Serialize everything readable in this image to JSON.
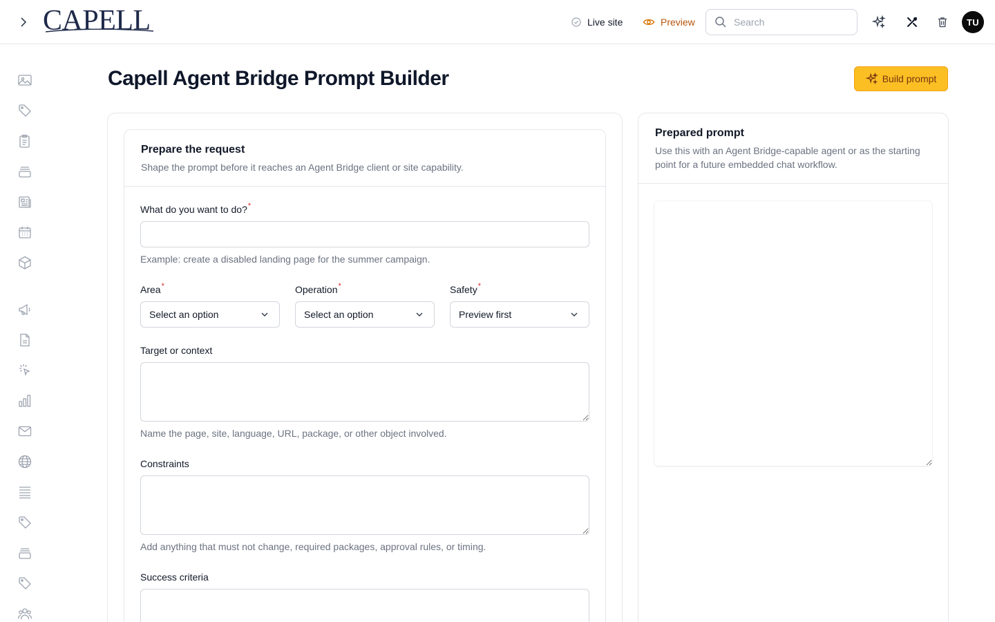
{
  "header": {
    "logo_text": "CAPELL",
    "live_site_label": "Live site",
    "preview_label": "Preview",
    "search_placeholder": "Search",
    "avatar_initials": "TU"
  },
  "page": {
    "title": "Capell Agent Bridge Prompt Builder",
    "build_button_label": "Build prompt"
  },
  "form": {
    "title": "Prepare the request",
    "subtitle": "Shape the prompt before it reaches an Agent Bridge client or site capability.",
    "goal": {
      "label": "What do you want to do?",
      "value": "",
      "help": "Example: create a disabled landing page for the summer campaign."
    },
    "area": {
      "label": "Area",
      "value": "Select an option"
    },
    "operation": {
      "label": "Operation",
      "value": "Select an option"
    },
    "safety": {
      "label": "Safety",
      "value": "Preview first"
    },
    "target": {
      "label": "Target or context",
      "value": "",
      "help": "Name the page, site, language, URL, package, or other object involved."
    },
    "constraints": {
      "label": "Constraints",
      "value": "",
      "help": "Add anything that must not change, required packages, approval rules, or timing."
    },
    "success": {
      "label": "Success criteria",
      "value": ""
    },
    "required_marker": "*"
  },
  "prepared": {
    "title": "Prepared prompt",
    "subtitle": "Use this with an Agent Bridge-capable agent or as the starting point for a future embedded chat workflow.",
    "value": ""
  },
  "colors": {
    "accent": "#fbbf24",
    "accent_border": "#f59e0b",
    "preview_text": "#b45309",
    "required": "#dc2626"
  },
  "sidebar_icons": [
    "image-icon",
    "tag-icon",
    "clipboard-icon",
    "archive-icon",
    "newspaper-icon",
    "calendar-icon",
    "cube-icon",
    "megaphone-icon",
    "document-icon",
    "cursor-click-icon",
    "bar-chart-icon",
    "mail-icon",
    "globe-icon",
    "list-icon",
    "tag-icon",
    "archive-icon",
    "tag-icon",
    "users-icon"
  ]
}
